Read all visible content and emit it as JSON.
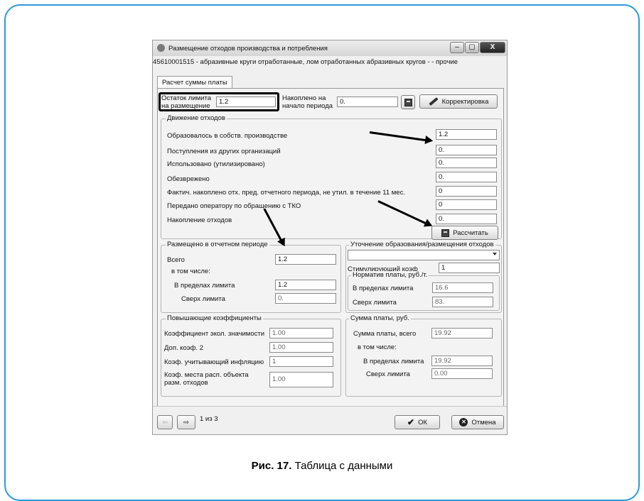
{
  "window": {
    "title": "Размещение отходов производства и потребления",
    "minimize": "–",
    "maximize": "▢",
    "close": "X"
  },
  "subheader": "45610001515 - абразивные круги отработанные, лом отработанных абразивных кругов - - прочие",
  "tab": "Расчет суммы платы",
  "top": {
    "limit_label": "Остаток лимита на размещение",
    "limit_value": "1.2",
    "accumulated_label": "Накоплено на начало периода",
    "accumulated_value": "0.",
    "correction_button": "Корректировка"
  },
  "movement": {
    "legend": "Движение отходов",
    "rows": [
      {
        "label": "Образовалось в собств. производстве",
        "value": "1.2"
      },
      {
        "label": "Поступления из других организаций",
        "value": "0."
      },
      {
        "label": "Использовано (утилизировано)",
        "value": "0."
      },
      {
        "label": "Обезврежено",
        "value": "0."
      },
      {
        "label": "Фактич. накоплено отх. пред. отчетного периода, не утил. в течение 11 мес.",
        "value": "0"
      },
      {
        "label": "Передано оператору по обращению с ТКО",
        "value": "0"
      },
      {
        "label": "Накопление отходов",
        "value": "0."
      }
    ],
    "calc_button": "Рассчитать"
  },
  "placed": {
    "legend": "Размещено в отчетном периоде",
    "total_label": "Всего",
    "total_value": "1.2",
    "including": "в том числе:",
    "within_label": "В пределах лимита",
    "within_value": "1.2",
    "over_label": "Сверх лимита",
    "over_value": "0."
  },
  "refine": {
    "legend": "Уточнение образования/размещения отходов",
    "combo_value": "",
    "stim_label": "Стимулирующий коэф",
    "stim_value": "1",
    "norm_legend": "Норматив платы, руб./т.",
    "within_label": "В пределах лимита",
    "within_value": "16.6",
    "over_label": "Сверх лимита",
    "over_value": "83."
  },
  "coefs": {
    "legend": "Повышающие коэффициенты",
    "rows": [
      {
        "label": "Коэффициент экол. значимости",
        "value": "1.00"
      },
      {
        "label": "Доп. коэф. 2",
        "value": "1.00"
      },
      {
        "label": "Коэф. учитывающий инфляцию",
        "value": "1"
      },
      {
        "label": "Коэф. места расп. объекта разм. отходов",
        "value": "1.00"
      }
    ]
  },
  "sum": {
    "legend": "Сумма платы, руб.",
    "total_label": "Сумма платы, всего",
    "total_value": "19.92",
    "including": "в том числе:",
    "within_label": "В пределах лимита",
    "within_value": "19.92",
    "over_label": "Сверх лимита",
    "over_value": "0.00"
  },
  "footer": {
    "back_icon": "⇦",
    "forward_icon": "⇨",
    "page": "1 из 3",
    "ok": "ОК",
    "cancel": "Отмена"
  },
  "caption": {
    "bold": "Рис. 17.",
    "text": " Таблица с данными"
  }
}
